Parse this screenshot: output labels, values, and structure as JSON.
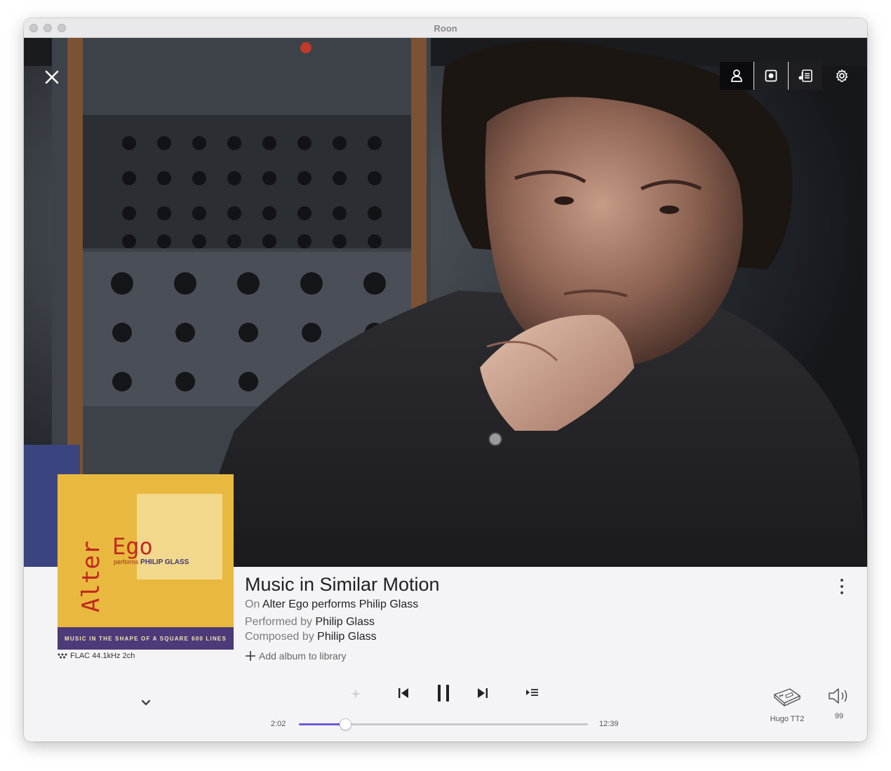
{
  "window": {
    "title": "Roon"
  },
  "toolbar": {
    "buttons": [
      {
        "icon": "person-icon",
        "active": true
      },
      {
        "icon": "speaker-icon",
        "active": true
      },
      {
        "icon": "lyrics-icon",
        "active": false
      },
      {
        "icon": "gear-icon",
        "active": false
      }
    ]
  },
  "album": {
    "cover_word1": "Alter",
    "cover_word2": "Ego",
    "cover_performs": "performs",
    "cover_artist": "PHILIP GLASS",
    "cover_band_left": "MUSIC IN THE SHAPE OF A SQUARE",
    "cover_band_right": "600 LINES",
    "colors": {
      "background": "#e9b93f",
      "band": "#4d3a78",
      "text": "#c02a1f"
    }
  },
  "format": {
    "label": "FLAC 44.1kHz 2ch"
  },
  "track": {
    "title": "Music in Similar Motion",
    "on_prefix": "On ",
    "album_name": "Alter Ego performs Philip Glass",
    "performed_prefix": "Performed by ",
    "performer": "Philip Glass",
    "composed_prefix": "Composed by ",
    "composer": "Philip Glass",
    "add_to_library": "Add album to library"
  },
  "playback": {
    "elapsed": "2:02",
    "duration": "12:39",
    "progress_fraction": 0.161,
    "state": "playing",
    "accent_color": "#6a5cd6"
  },
  "output": {
    "device_name": "Hugo TT2",
    "volume": "99"
  }
}
